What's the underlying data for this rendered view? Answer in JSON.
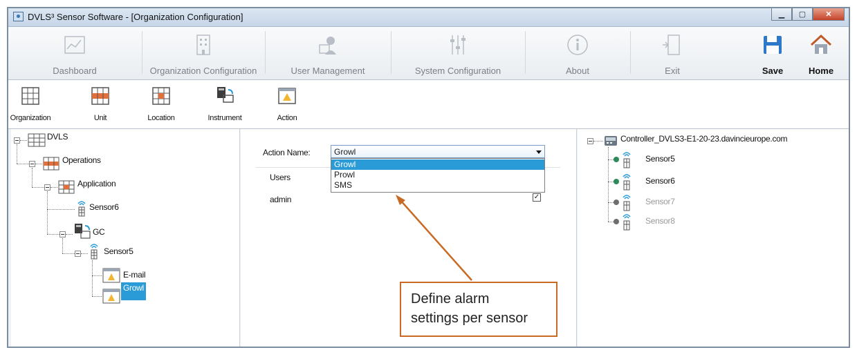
{
  "window": {
    "title": "DVLS³ Sensor Software - [Organization Configuration]"
  },
  "ribbon": {
    "dashboard": "Dashboard",
    "organization_configuration": "Organization Configuration",
    "user_management": "User Management",
    "system_configuration": "System Configuration",
    "about": "About",
    "exit": "Exit",
    "save": "Save",
    "home": "Home"
  },
  "subbar": {
    "organization": "Organization",
    "unit": "Unit",
    "location": "Location",
    "instrument": "Instrument",
    "action": "Action"
  },
  "tree": {
    "root": "DVLS",
    "operations": "Operations",
    "application": "Application",
    "sensor6": "Sensor6",
    "gc": "GC",
    "sensor5": "Sensor5",
    "email": "E-mail",
    "growl": "Growl"
  },
  "form": {
    "action_name_label": "Action Name:",
    "action_name_value": "Growl",
    "options": [
      "Growl",
      "Prowl",
      "SMS"
    ],
    "users_label": "Users",
    "user_admin": "admin",
    "checkmark": "✓"
  },
  "controller": {
    "name": "Controller_DVLS3-E1-20-23.davincieurope.com",
    "sensors": [
      "Sensor5",
      "Sensor6",
      "Sensor7",
      "Sensor8"
    ]
  },
  "callout": {
    "line1": "Define alarm",
    "line2": "settings per sensor"
  },
  "colors": {
    "accent": "#2a9bd7",
    "callout_border": "#c86a24"
  }
}
